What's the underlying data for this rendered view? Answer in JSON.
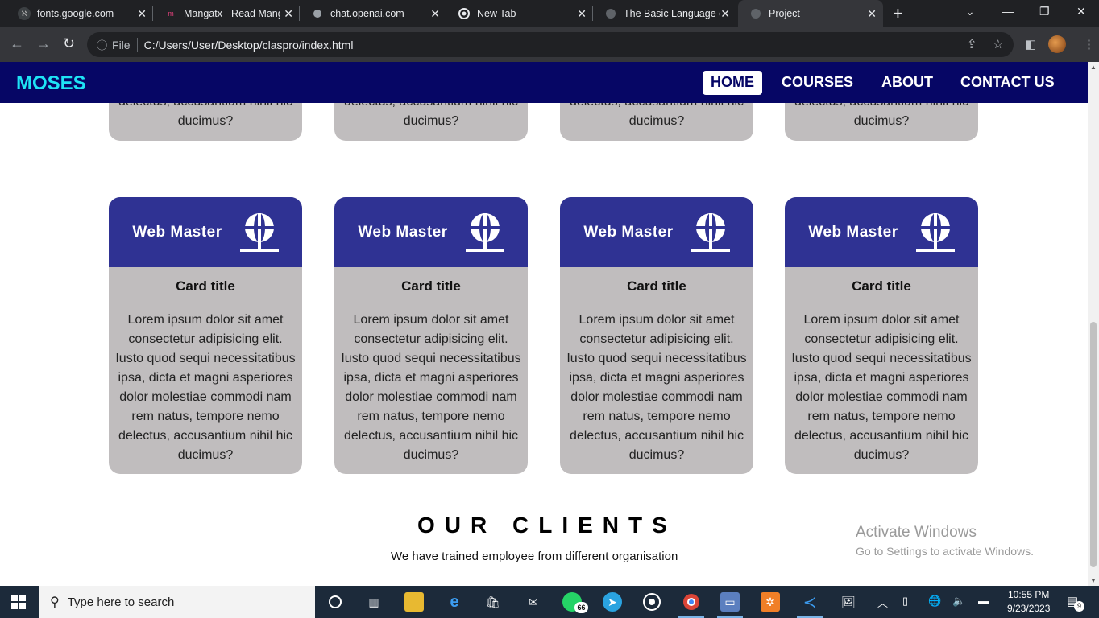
{
  "browser": {
    "tabs": [
      {
        "label": "fonts.google.com"
      },
      {
        "label": "Mangatx - Read Manga"
      },
      {
        "label": "chat.openai.com"
      },
      {
        "label": "New Tab"
      },
      {
        "label": "The Basic Language of"
      },
      {
        "label": "Project"
      }
    ],
    "address": {
      "scheme_label": "File",
      "url": "C:/Users/User/Desktop/claspro/index.html"
    }
  },
  "site": {
    "brand": "MOSES",
    "nav": [
      "HOME",
      "COURSES",
      "ABOUT",
      "CONTACT US"
    ],
    "active_nav": "HOME",
    "top_cards": [
      {
        "text": "delectus, accusantium nihil hic ducimus?"
      },
      {
        "text": "delectus, accusantium nihil hic ducimus?"
      },
      {
        "text": "delectus, accusantium nihil hic ducimus?"
      },
      {
        "text": "delectus, accusantium nihil hic ducimus?"
      }
    ],
    "cards": [
      {
        "banner": "Web Master",
        "title": "Card title",
        "text": "Lorem ipsum dolor sit amet consectetur adipisicing elit. Iusto quod sequi necessitatibus ipsa, dicta et magni asperiores dolor molestiae commodi nam rem natus, tempore nemo delectus, accusantium nihil hic ducimus?"
      },
      {
        "banner": "Web Master",
        "title": "Card title",
        "text": "Lorem ipsum dolor sit amet consectetur adipisicing elit. Iusto quod sequi necessitatibus ipsa, dicta et magni asperiores dolor molestiae commodi nam rem natus, tempore nemo delectus, accusantium nihil hic ducimus?"
      },
      {
        "banner": "Web Master",
        "title": "Card title",
        "text": "Lorem ipsum dolor sit amet consectetur adipisicing elit. Iusto quod sequi necessitatibus ipsa, dicta et magni asperiores dolor molestiae commodi nam rem natus, tempore nemo delectus, accusantium nihil hic ducimus?"
      },
      {
        "banner": "Web Master",
        "title": "Card title",
        "text": "Lorem ipsum dolor sit amet consectetur adipisicing elit. Iusto quod sequi necessitatibus ipsa, dicta et magni asperiores dolor molestiae commodi nam rem natus, tempore nemo delectus, accusantium nihil hic ducimus?"
      }
    ],
    "clients": {
      "title": "OUR CLIENTS",
      "subtitle": "We have trained employee from different organisation"
    }
  },
  "watermark": {
    "line1": "Activate Windows",
    "line2": "Go to Settings to activate Windows."
  },
  "taskbar": {
    "search_placeholder": "Type here to search",
    "whatsapp_badge": "66",
    "time": "10:55 PM",
    "date": "9/23/2023",
    "notification_count": "9"
  },
  "colors": {
    "site_nav": "#060665",
    "brand": "#1ee3f5",
    "card_bg": "#c0bdbe",
    "card_banner": "#2f3293"
  }
}
